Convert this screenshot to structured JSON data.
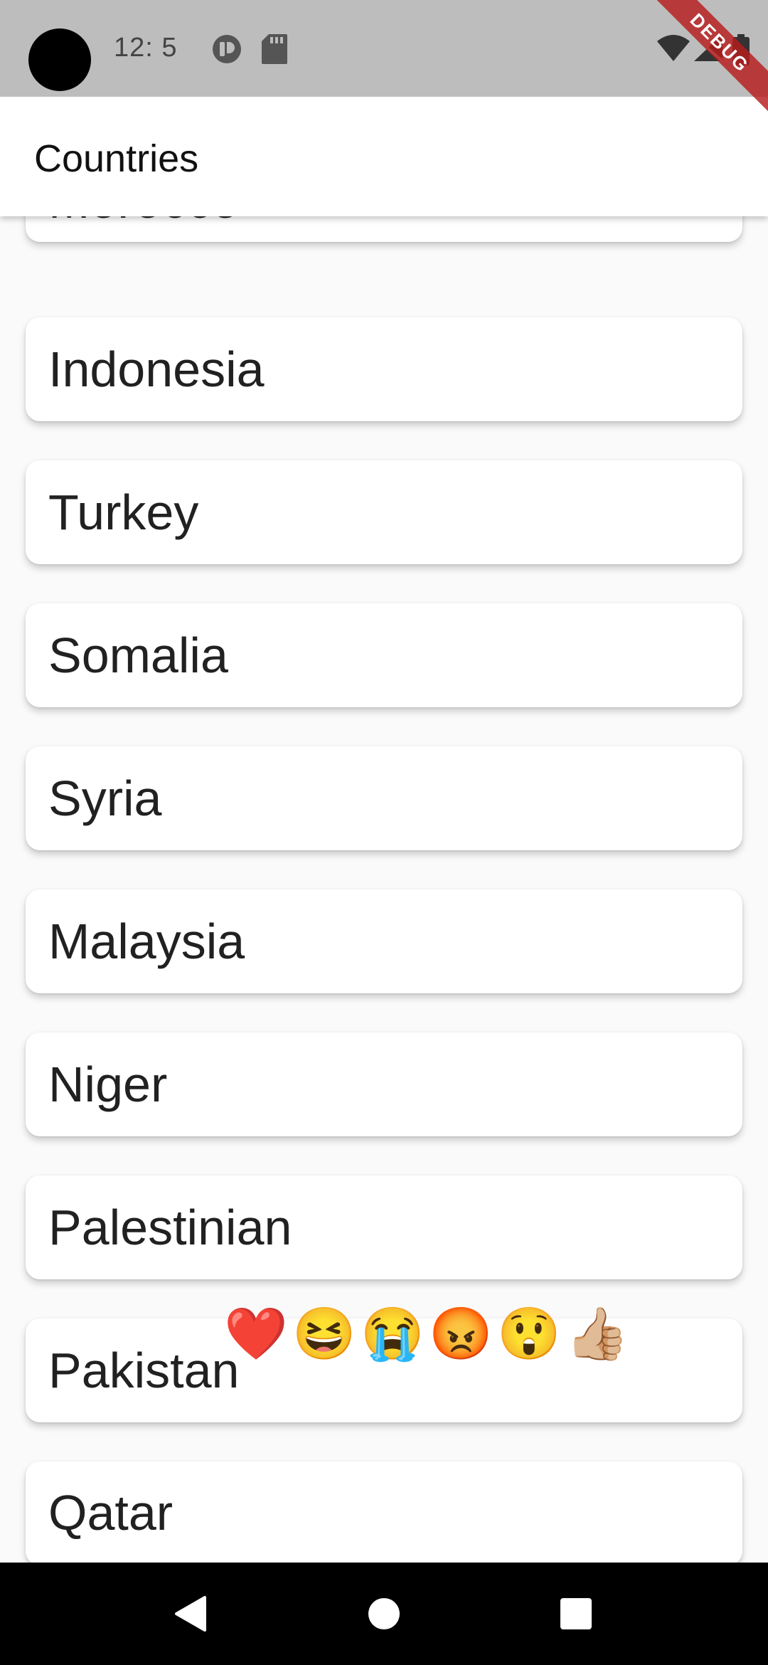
{
  "status_bar": {
    "time": "12: 5",
    "debug_label": "DEBUG"
  },
  "app_bar": {
    "title": "Countries"
  },
  "countries": [
    "Morocco",
    "Indonesia",
    "Turkey",
    "Somalia",
    "Syria",
    "Malaysia",
    "Niger",
    "Palestinian",
    "Pakistan",
    "Qatar"
  ],
  "reactions": [
    "❤️",
    "😆",
    "😭",
    "😡",
    "😲",
    "👍🏼"
  ],
  "colors": {
    "status_bar_bg": "#bdbdbd",
    "app_bar_bg": "#ffffff",
    "list_bg": "#fafafa",
    "card_bg": "#ffffff",
    "nav_bar_bg": "#000000",
    "debug_ribbon": "#b71c1c"
  }
}
